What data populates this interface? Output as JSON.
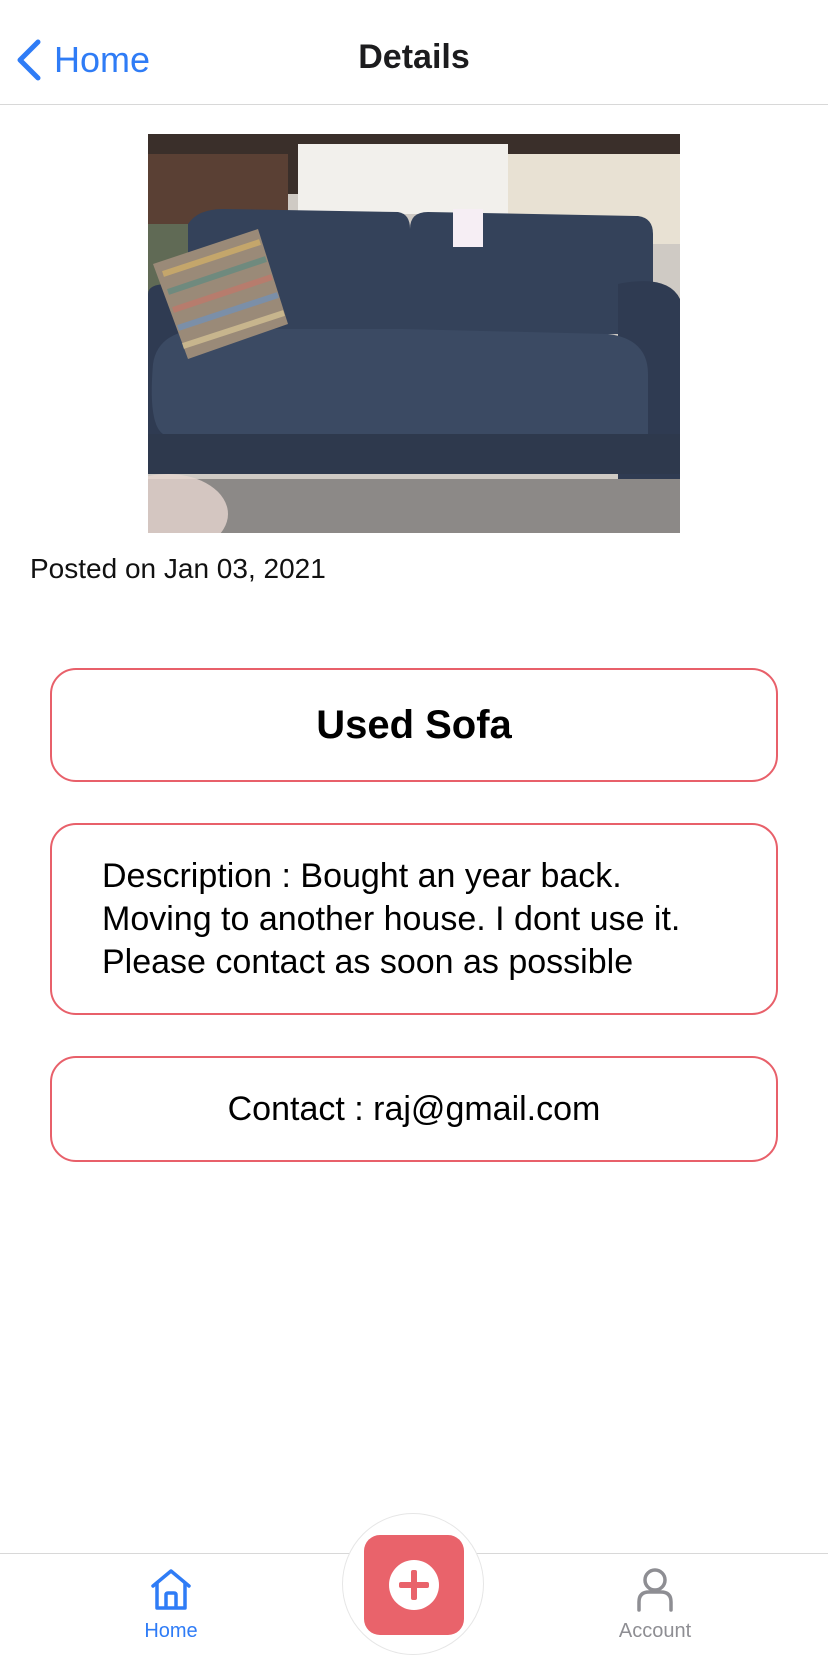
{
  "header": {
    "back_label": "Home",
    "title": "Details"
  },
  "listing": {
    "image_icon": "sofa-photo",
    "posted": "Posted on Jan 03, 2021",
    "title": "Used Sofa",
    "description": "Description : Bought an year back. Moving to another house. I dont use it. Please contact as soon as possible",
    "contact": "Contact : raj@gmail.com"
  },
  "tabbar": {
    "home_label": "Home",
    "account_label": "Account",
    "add_icon": "plus-icon"
  },
  "colors": {
    "accent": "#2f7cf6",
    "card_border": "#e8606a",
    "fab": "#e9636b",
    "inactive": "#8e8e93"
  }
}
